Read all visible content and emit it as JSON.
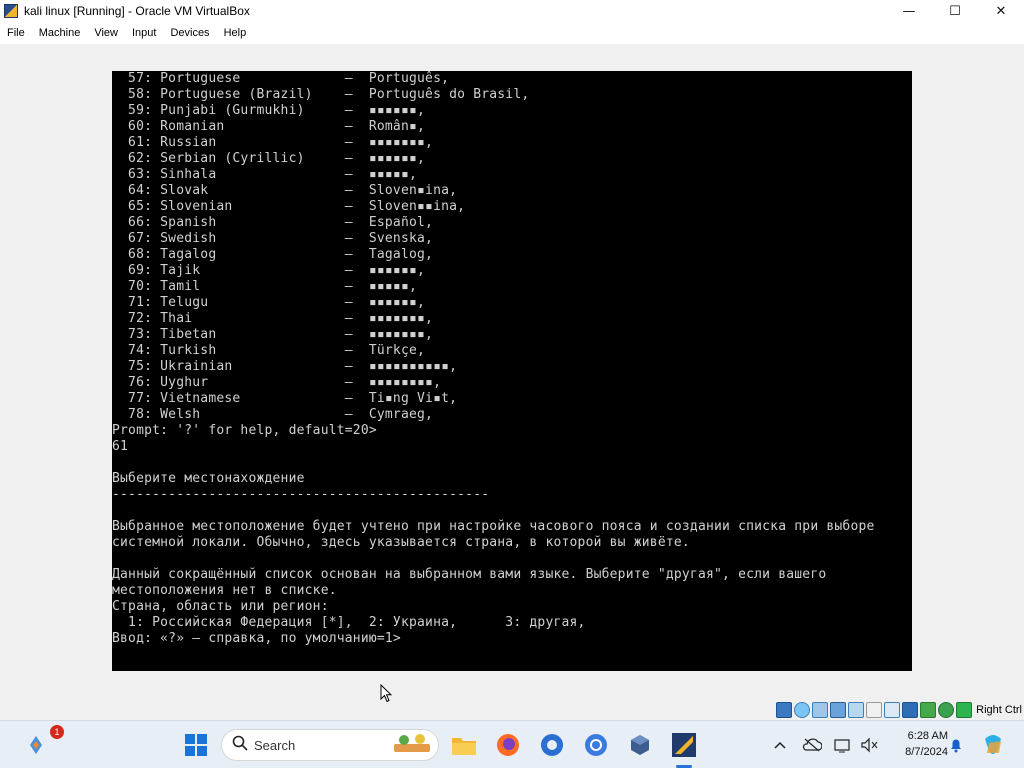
{
  "window": {
    "title": "kali linux [Running] - Oracle VM VirtualBox",
    "controls": {
      "minimize": "—",
      "maximize": "☐",
      "close": "✕"
    }
  },
  "menu": [
    "File",
    "Machine",
    "View",
    "Input",
    "Devices",
    "Help"
  ],
  "console": {
    "lines": [
      "  57: Portuguese             –  Português,",
      "  58: Portuguese (Brazil)    –  Português do Brasil,",
      "  59: Punjabi (Gurmukhi)     –  ▪▪▪▪▪▪,",
      "  60: Romanian               –  Român▪,",
      "  61: Russian                –  ▪▪▪▪▪▪▪,",
      "  62: Serbian (Cyrillic)     –  ▪▪▪▪▪▪,",
      "  63: Sinhala                –  ▪▪▪▪▪,",
      "  64: Slovak                 –  Sloven▪ina,",
      "  65: Slovenian              –  Sloven▪▪ina,",
      "  66: Spanish                –  Español,",
      "  67: Swedish                –  Svenska,",
      "  68: Tagalog                –  Tagalog,",
      "  69: Tajik                  –  ▪▪▪▪▪▪,",
      "  70: Tamil                  –  ▪▪▪▪▪,",
      "  71: Telugu                 –  ▪▪▪▪▪▪,",
      "  72: Thai                   –  ▪▪▪▪▪▪▪,",
      "  73: Tibetan                –  ▪▪▪▪▪▪▪,",
      "  74: Turkish                –  Türkçe,",
      "  75: Ukrainian              –  ▪▪▪▪▪▪▪▪▪▪,",
      "  76: Uyghur                 –  ▪▪▪▪▪▪▪▪,",
      "  77: Vietnamese             –  Ti▪ng Vi▪t,",
      "  78: Welsh                  –  Cymraeg,",
      "Prompt: '?' for help, default=20>",
      "61",
      "",
      "Выберите местонахождение",
      "-----------------------------------------------",
      "",
      "Выбранное местоположение будет учтено при настройке часового пояса и создании списка при выборе",
      "системной локали. Обычно, здесь указывается страна, в которой вы живёте.",
      "",
      "Данный сокращённый список основан на выбранном вами языке. Выберите \"другая\", если вашего",
      "местоположения нет в списке.",
      "Страна, область или регион:",
      "  1: Российская Федерация [*],  2: Украина,      3: другая,",
      "Ввод: «?» – справка, по умолчанию=1>"
    ]
  },
  "statusbar": {
    "host_key": "Right Ctrl"
  },
  "taskbar": {
    "search_placeholder": "Search",
    "notification_count": "1",
    "clock_time": "6:28 AM",
    "clock_date": "8/7/2024"
  },
  "colors": {
    "console_bg": "#000000",
    "console_fg": "#d0d0d0",
    "windows_accent": "#0067c0"
  }
}
